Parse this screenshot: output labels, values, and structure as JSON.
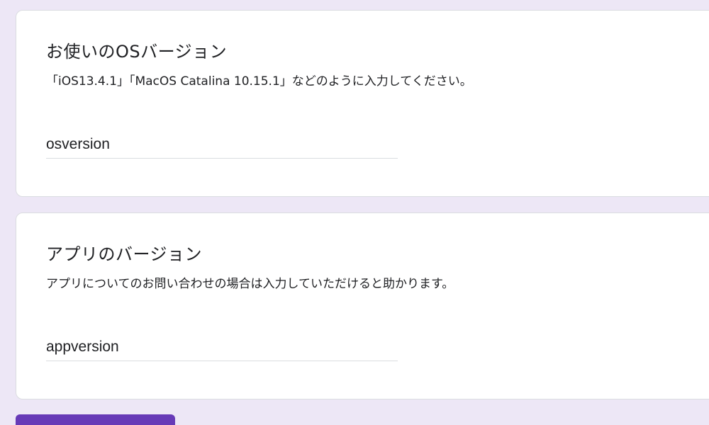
{
  "questions": [
    {
      "title": "お使いのOSバージョン",
      "help": "「iOS13.4.1」「MacOS Catalina 10.15.1」などのように入力してください。",
      "answer_value": "osversion"
    },
    {
      "title": "アプリのバージョン",
      "help": "アプリについてのお問い合わせの場合は入力していただけると助かります。",
      "answer_value": "appversion"
    }
  ],
  "colors": {
    "page_background": "#ede7f6",
    "card_background": "#ffffff",
    "accent": "#673ab7",
    "text": "#202124",
    "divider": "#dadce0"
  }
}
